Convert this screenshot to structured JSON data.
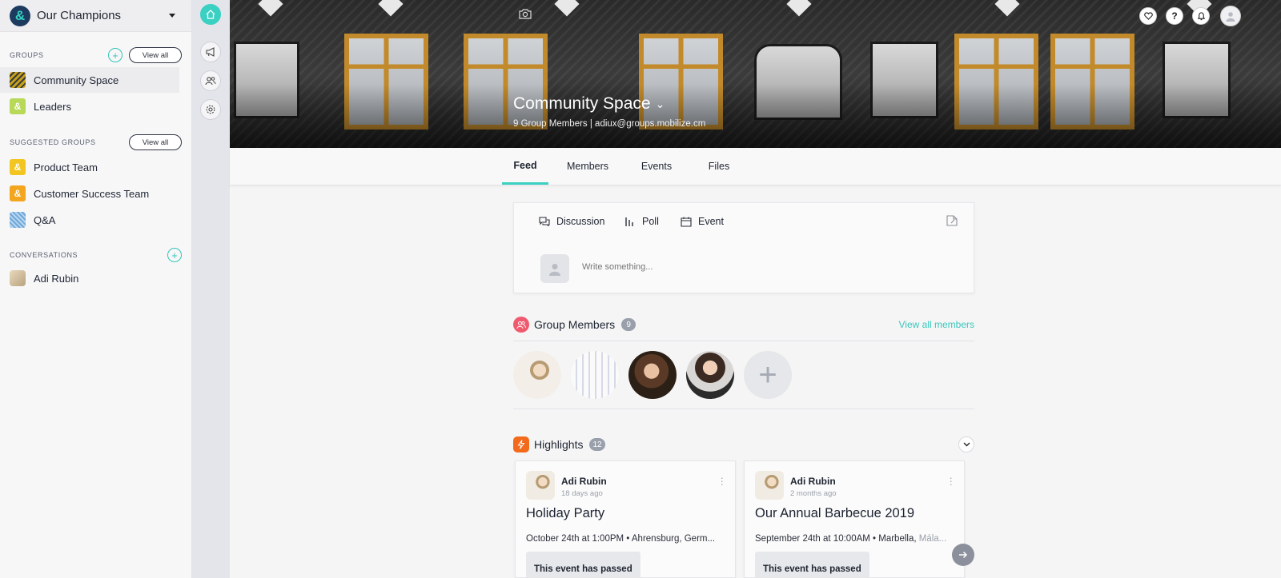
{
  "org": {
    "name": "Our Champions"
  },
  "sidebar": {
    "groups": {
      "title": "GROUPS",
      "view_all": "View all",
      "items": [
        {
          "label": "Community Space",
          "color": "#c8a21c"
        },
        {
          "label": "Leaders",
          "color": "#b7d957"
        }
      ]
    },
    "suggested": {
      "title": "SUGGESTED GROUPS",
      "view_all": "View all",
      "items": [
        {
          "label": "Product Team",
          "color": "#f2c520"
        },
        {
          "label": "Customer Success Team",
          "color": "#f3a51e"
        },
        {
          "label": "Q&A",
          "color": "#6ea7d8"
        }
      ]
    },
    "conversations": {
      "title": "CONVERSATIONS",
      "items": [
        {
          "label": "Adi Rubin"
        }
      ]
    }
  },
  "hero": {
    "title": "Community Space",
    "subtitle": "9 Group Members | adiux@groups.mobilize.cm"
  },
  "tabs": [
    "Feed",
    "Members",
    "Events",
    "Files"
  ],
  "composer": {
    "types": [
      "Discussion",
      "Poll",
      "Event"
    ],
    "placeholder": "Write something..."
  },
  "members": {
    "title": "Group Members",
    "count": "9",
    "view_all": "View all members"
  },
  "highlights": {
    "title": "Highlights",
    "count": "12",
    "cards": [
      {
        "author": "Adi Rubin",
        "time": "18 days ago",
        "title": "Holiday Party",
        "meta": "October 24th at 1:00PM • Ahrensburg, Germ...",
        "status": "This event has passed"
      },
      {
        "author": "Adi Rubin",
        "time": "2 months ago",
        "title": "Our Annual Barbecue 2019",
        "meta": "September 24th at 10:00AM • Marbella, ",
        "meta_fade": "Mála...",
        "status": "This event has passed"
      }
    ]
  },
  "colors": {
    "accent": "#3ad0c2",
    "members_icon": "#ef5a6f",
    "highlights_icon": "#f26a1b"
  }
}
